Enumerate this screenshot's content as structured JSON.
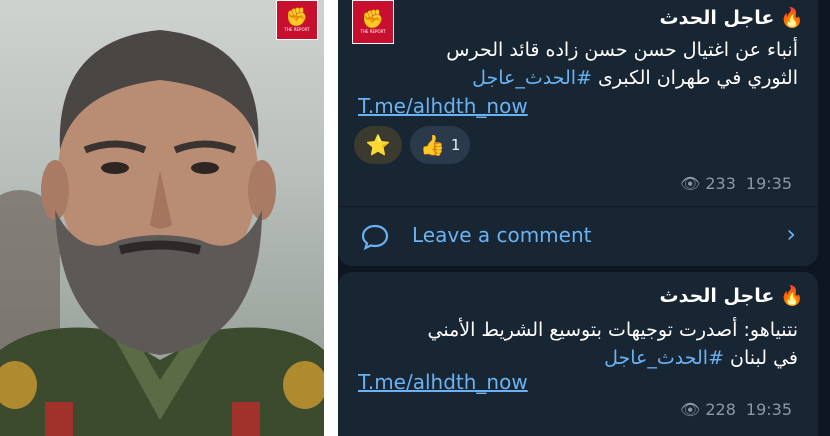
{
  "photo": {
    "badge_caption": "THE REPORT"
  },
  "messages": [
    {
      "title": "عاجل الحدث",
      "fire_icon": "fire-icon",
      "body_line1": "أنباء عن اغتيال حسن حسن  زاده قائد الحرس",
      "body_line2_text": "الثوري في طهران الكبرى ",
      "body_line2_hashtag": "#الحدث_عاجل",
      "link": "T.me/alhdth_now",
      "reactions": [
        {
          "emoji": "⭐",
          "count": ""
        },
        {
          "emoji": "👍",
          "count": "1"
        }
      ],
      "views": "233",
      "time": "19:35",
      "comment_label": "Leave a comment"
    },
    {
      "title": "عاجل الحدث",
      "fire_icon": "fire-icon",
      "body_line1": "نتنياهو: أصدرت توجيهات بتوسيع الشريط الأمني",
      "body_line2_text": "في لبنان  ",
      "body_line2_hashtag": "#الحدث_عاجل",
      "link": "T.me/alhdth_now",
      "views": "228",
      "time": "19:35"
    }
  ],
  "colors": {
    "chat_background": "#0e1621",
    "bubble": "#182533",
    "accent_link": "#6ab2f2",
    "meta_text": "#8a97a6"
  }
}
